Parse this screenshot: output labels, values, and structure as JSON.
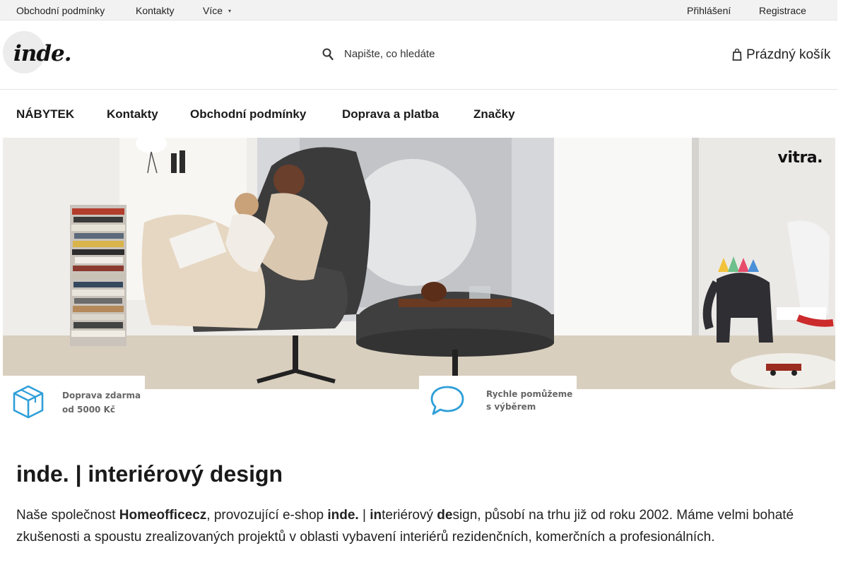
{
  "topbar": {
    "links": [
      "Obchodní podmínky",
      "Kontakty",
      "Více"
    ],
    "account": [
      "Přihlášení",
      "Registrace"
    ]
  },
  "header": {
    "logo_text": "inde.",
    "search_placeholder": "Napište, co hledáte",
    "cart_label": "Prázdný košík"
  },
  "mainnav": [
    "NÁBYTEK",
    "Kontakty",
    "Obchodní podmínky",
    "Doprava a platba",
    "Značky"
  ],
  "hero": {
    "brand": "vitra."
  },
  "benefits": [
    {
      "line1": "Doprava zdarma",
      "line2": "od 5000 Kč",
      "icon": "box-icon"
    },
    {
      "line1": "Rychle pomůžeme",
      "line2": "s výběrem",
      "icon": "chat-bubble-icon"
    }
  ],
  "content": {
    "title": "inde. | interiérový design",
    "intro": {
      "p1": "Naše společnost ",
      "company": "Homeofficecz",
      "p2": ", provozující e-shop ",
      "shop": "inde.",
      "p3": " | ",
      "in": "in",
      "p4": "teriérový ",
      "de": "de",
      "p5": "sign, působí na trhu již od roku 2002. Máme velmi bohaté zkušenosti a spoustu zrealizovaných projektů v oblasti vybavení interiérů rezidenčních, komerčních a profesionálních."
    }
  },
  "colors": {
    "accent": "#2f9fd8",
    "topbar_bg": "#f2f2f2",
    "text": "#1a1a1a"
  }
}
